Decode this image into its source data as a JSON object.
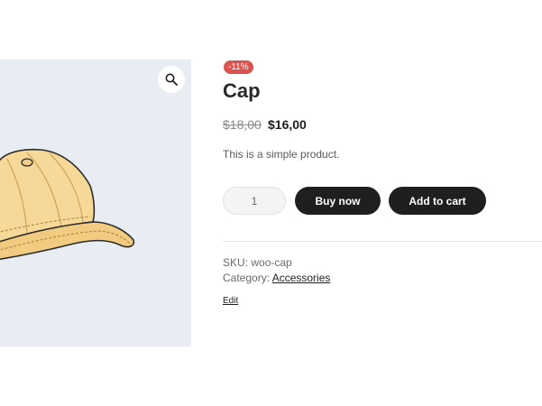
{
  "product": {
    "sale_badge": "-11%",
    "title": "Cap",
    "price_regular": "$18,00",
    "price_sale": "$16,00",
    "short_description": "This is a simple product."
  },
  "cart_form": {
    "quantity_value": "1",
    "buy_now_label": "Buy now",
    "add_to_cart_label": "Add to cart"
  },
  "meta": {
    "sku_label": "SKU:",
    "sku_value": "woo-cap",
    "category_label": "Category:",
    "category_value": "Accessories"
  },
  "admin": {
    "edit_label": "Edit"
  },
  "icons": {
    "zoom": "magnifier-icon",
    "product_image": "cap-image"
  },
  "colors": {
    "badge": "#d9534f",
    "button": "#1f1f1f",
    "gallery_bg": "#e8edf3"
  }
}
